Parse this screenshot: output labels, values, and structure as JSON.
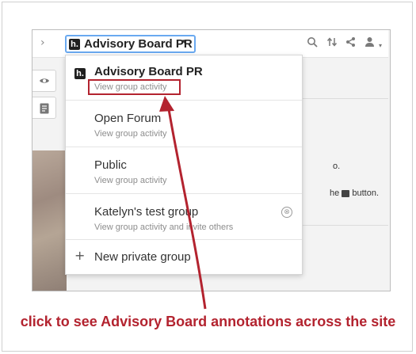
{
  "toolbar": {
    "collapse_glyph": "›",
    "logo_text": "h.",
    "group_name": "Advisory Board PR",
    "caret_glyph": "▾",
    "icons": [
      "search-icon",
      "share-sort-icon",
      "share-icon",
      "user-icon",
      "chevron-down-icon"
    ]
  },
  "sidebar_tabs": [
    {
      "icon": "eye-icon"
    },
    {
      "icon": "notes-icon"
    }
  ],
  "background_text": {
    "line1_suffix": "o.",
    "line2_prefix": "he",
    "line2_suffix": "button."
  },
  "dropdown": {
    "items": [
      {
        "name": "Advisory Board PR",
        "sub": "View group activity",
        "current": true
      },
      {
        "name": "Open Forum",
        "sub": "View group activity"
      },
      {
        "name": "Public",
        "sub": "View group activity"
      },
      {
        "name": "Katelyn's test group",
        "sub": "View group activity and invite others",
        "leave_icon": "⊗"
      }
    ],
    "new_group": {
      "plus": "+",
      "label": "New private group"
    }
  },
  "annotation": {
    "caption": "click to see Advisory Board annotations across the site",
    "color": "#b3232f"
  }
}
